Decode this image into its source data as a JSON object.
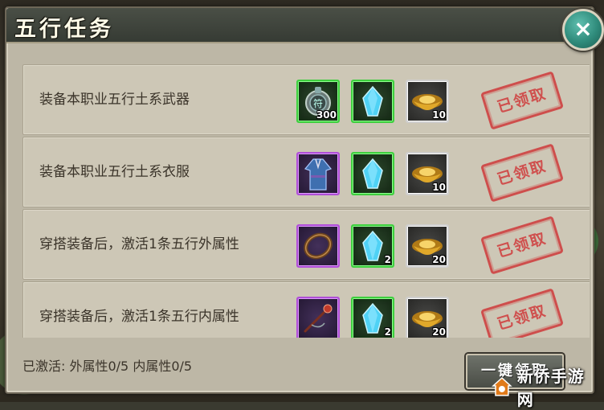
{
  "window": {
    "title": "五行任务",
    "close_label": "×"
  },
  "tasks": [
    {
      "label": "装备本职业五行土系武器",
      "rewards": [
        {
          "icon": "ward-medallion-icon",
          "frame": "green",
          "qty": "300"
        },
        {
          "icon": "blue-crystal-icon",
          "frame": "green",
          "qty": ""
        },
        {
          "icon": "gold-ingot-icon",
          "frame": "grey",
          "qty": "10"
        }
      ],
      "stamp": "已领取"
    },
    {
      "label": "装备本职业五行土系衣服",
      "rewards": [
        {
          "icon": "blue-robe-icon",
          "frame": "purple",
          "qty": ""
        },
        {
          "icon": "blue-crystal-icon",
          "frame": "green",
          "qty": ""
        },
        {
          "icon": "gold-ingot-icon",
          "frame": "grey",
          "qty": "10"
        }
      ],
      "stamp": "已领取"
    },
    {
      "label": "穿搭装备后，激活1条五行外属性",
      "rewards": [
        {
          "icon": "bracelet-icon",
          "frame": "purple",
          "qty": ""
        },
        {
          "icon": "blue-crystal-icon",
          "frame": "green",
          "qty": "2"
        },
        {
          "icon": "gold-ingot-icon",
          "frame": "grey",
          "qty": "20"
        }
      ],
      "stamp": "已领取"
    },
    {
      "label": "穿搭装备后，激活1条五行内属性",
      "rewards": [
        {
          "icon": "hairpin-icon",
          "frame": "purple",
          "qty": ""
        },
        {
          "icon": "blue-crystal-icon",
          "frame": "green",
          "qty": "2"
        },
        {
          "icon": "gold-ingot-icon",
          "frame": "grey",
          "qty": "20"
        }
      ],
      "stamp": "已领取"
    }
  ],
  "footer": {
    "status": "已激活: 外属性0/5  内属性0/5",
    "claim_all_label": "一键领取"
  },
  "watermark": {
    "text": "新侨手游网"
  },
  "colors": {
    "panel": "#bdb7a6",
    "row": "#cdc7b6",
    "stamp_red": "#d03c3c",
    "close_teal": "#2f8b7b",
    "frame_green": "#3fcf3f",
    "frame_purple": "#b04fd8"
  }
}
